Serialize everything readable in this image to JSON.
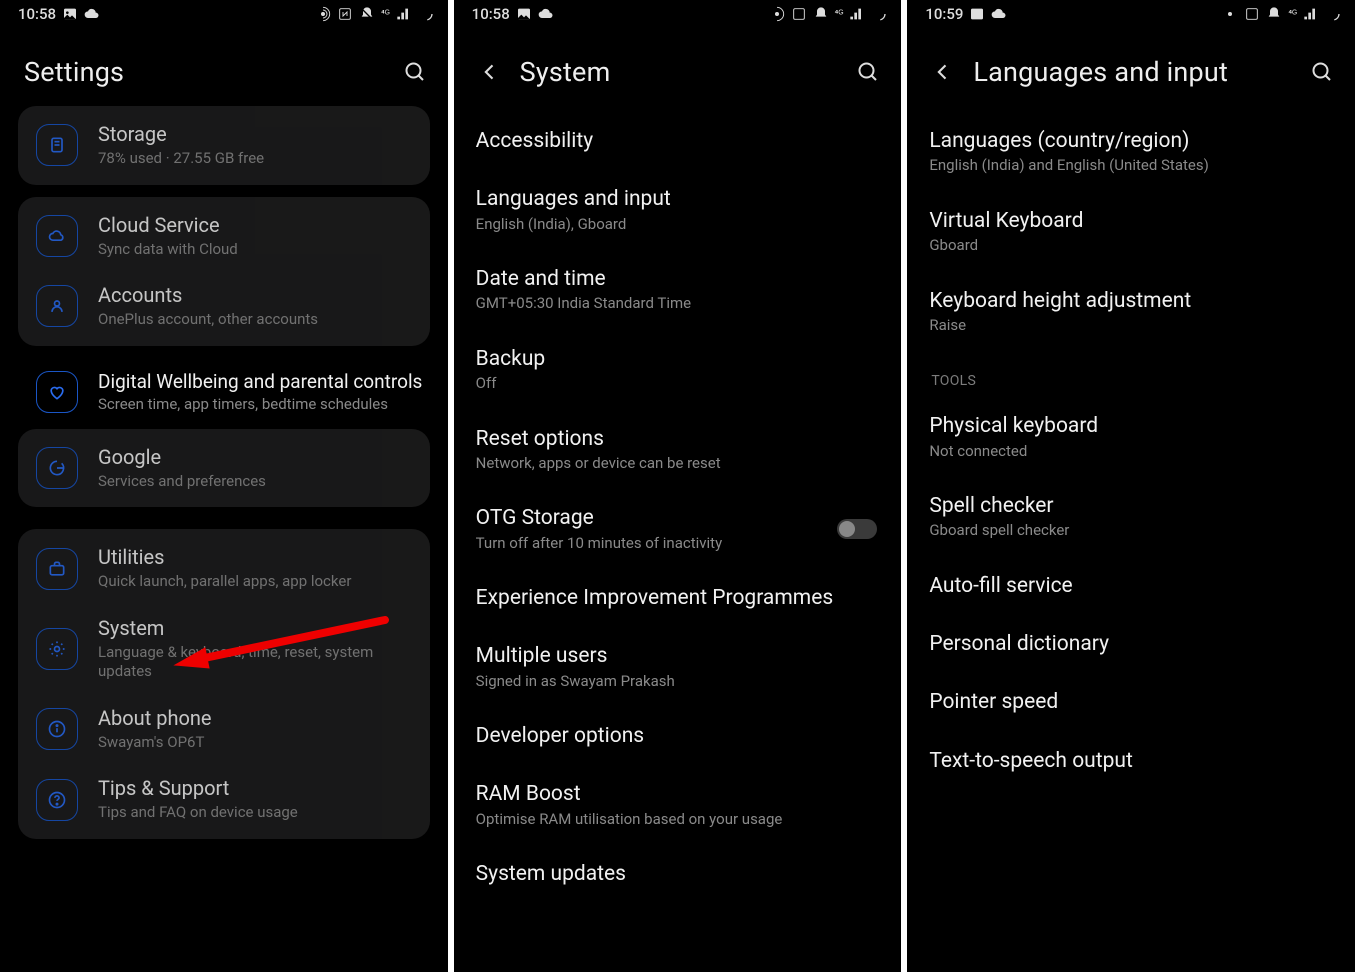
{
  "statusbar": {
    "time1": "10:58",
    "time2": "10:58",
    "time3": "10:59"
  },
  "screen1": {
    "title": "Settings",
    "storage": {
      "title": "Storage",
      "sub": "78% used · 27.55 GB free"
    },
    "cloud": {
      "title": "Cloud Service",
      "sub": "Sync data with Cloud"
    },
    "accounts": {
      "title": "Accounts",
      "sub": "OnePlus account, other accounts"
    },
    "wellbeing": {
      "title": "Digital Wellbeing and parental controls",
      "sub": "Screen time, app timers, bedtime schedules"
    },
    "google": {
      "title": "Google",
      "sub": "Services and preferences"
    },
    "utilities": {
      "title": "Utilities",
      "sub": "Quick launch, parallel apps, app locker"
    },
    "system": {
      "title": "System",
      "sub": "Language & keyboard, time, reset, system updates"
    },
    "about": {
      "title": "About phone",
      "sub": "Swayam's OP6T"
    },
    "tips": {
      "title": "Tips & Support",
      "sub": "Tips and FAQ on device usage"
    }
  },
  "screen2": {
    "title": "System",
    "accessibility": {
      "title": "Accessibility"
    },
    "languages": {
      "title": "Languages and input",
      "sub": "English (India), Gboard"
    },
    "datetime": {
      "title": "Date and time",
      "sub": "GMT+05:30 India Standard Time"
    },
    "backup": {
      "title": "Backup",
      "sub": "Off"
    },
    "reset": {
      "title": "Reset options",
      "sub": "Network, apps or device can be reset"
    },
    "otg": {
      "title": "OTG Storage",
      "sub": "Turn off after 10 minutes of inactivity"
    },
    "eip": {
      "title": "Experience Improvement Programmes"
    },
    "users": {
      "title": "Multiple users",
      "sub": "Signed in as Swayam Prakash"
    },
    "dev": {
      "title": "Developer options"
    },
    "ram": {
      "title": "RAM Boost",
      "sub": "Optimise RAM utilisation based on your usage"
    },
    "sysup": {
      "title": "System updates"
    }
  },
  "screen3": {
    "title": "Languages and input",
    "langs": {
      "title": "Languages (country/region)",
      "sub": "English (India) and English (United States)"
    },
    "vkb": {
      "title": "Virtual Keyboard",
      "sub": "Gboard"
    },
    "kheight": {
      "title": "Keyboard height adjustment",
      "sub": "Raise"
    },
    "tools_label": "TOOLS",
    "pkb": {
      "title": "Physical keyboard",
      "sub": "Not connected"
    },
    "spell": {
      "title": "Spell checker",
      "sub": "Gboard spell checker"
    },
    "autofill": {
      "title": "Auto-fill service"
    },
    "pdict": {
      "title": "Personal dictionary"
    },
    "pointer": {
      "title": "Pointer speed"
    },
    "tts": {
      "title": "Text-to-speech output"
    }
  }
}
